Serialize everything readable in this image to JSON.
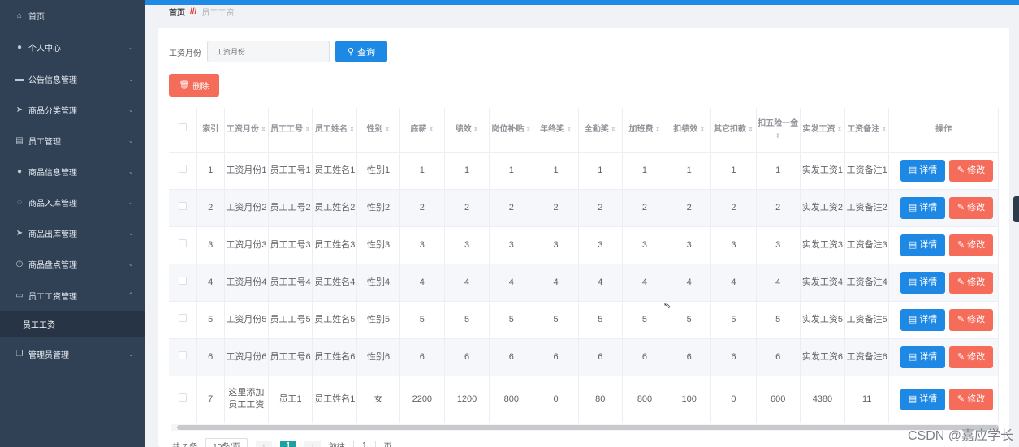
{
  "colors": {
    "primary": "#1e88e5",
    "danger": "#f56c5b",
    "sidebar_bg": "#304156"
  },
  "sidebar": {
    "items": [
      {
        "icon": "home-icon",
        "glyph": "⌂",
        "label": "首页",
        "chevron": false
      },
      {
        "icon": "user-icon",
        "glyph": "●",
        "label": "个人中心",
        "chevron": true
      },
      {
        "icon": "notice-icon",
        "glyph": "▬",
        "label": "公告信息管理",
        "chevron": true
      },
      {
        "icon": "send-icon",
        "glyph": "➤",
        "label": "商品分类管理",
        "chevron": true
      },
      {
        "icon": "staff-icon",
        "glyph": "▤",
        "label": "员工管理",
        "chevron": true
      },
      {
        "icon": "goods-icon",
        "glyph": "●",
        "label": "商品信息管理",
        "chevron": true
      },
      {
        "icon": "inbound-icon",
        "glyph": "◌",
        "label": "商品入库管理",
        "chevron": true
      },
      {
        "icon": "outbound-icon",
        "glyph": "➤",
        "label": "商品出库管理",
        "chevron": true
      },
      {
        "icon": "clock-icon",
        "glyph": "◷",
        "label": "商品盘点管理",
        "chevron": true
      },
      {
        "icon": "salary-icon",
        "glyph": "▭",
        "label": "员工工资管理",
        "chevron": true
      },
      {
        "icon": "copy-icon",
        "glyph": "❐",
        "label": "管理员管理",
        "chevron": true
      }
    ],
    "submenu_label": "员工工资"
  },
  "breadcrumb": {
    "home": "首页",
    "separator": "///",
    "current": "员工工资"
  },
  "search": {
    "label": "工资月份",
    "placeholder": "工资月份",
    "query_label": "查询"
  },
  "delete_label": "删除",
  "table": {
    "headers": [
      "",
      "索引",
      "工资月份",
      "员工工号",
      "员工姓名",
      "性别",
      "底薪",
      "绩效",
      "岗位补贴",
      "年终奖",
      "全勤奖",
      "加班费",
      "扣绩效",
      "其它扣款",
      "扣五险一金",
      "实发工资",
      "工资备注",
      "操作"
    ],
    "detail_label": "详情",
    "edit_label": "修改",
    "rows": [
      [
        "1",
        "工资月份1",
        "员工工号1",
        "员工姓名1",
        "性别1",
        "1",
        "1",
        "1",
        "1",
        "1",
        "1",
        "1",
        "1",
        "1",
        "实发工资1",
        "工资备注1"
      ],
      [
        "2",
        "工资月份2",
        "员工工号2",
        "员工姓名2",
        "性别2",
        "2",
        "2",
        "2",
        "2",
        "2",
        "2",
        "2",
        "2",
        "2",
        "实发工资2",
        "工资备注2"
      ],
      [
        "3",
        "工资月份3",
        "员工工号3",
        "员工姓名3",
        "性别3",
        "3",
        "3",
        "3",
        "3",
        "3",
        "3",
        "3",
        "3",
        "3",
        "实发工资3",
        "工资备注3"
      ],
      [
        "4",
        "工资月份4",
        "员工工号4",
        "员工姓名4",
        "性别4",
        "4",
        "4",
        "4",
        "4",
        "4",
        "4",
        "4",
        "4",
        "4",
        "实发工资4",
        "工资备注4"
      ],
      [
        "5",
        "工资月份5",
        "员工工号5",
        "员工姓名5",
        "性别5",
        "5",
        "5",
        "5",
        "5",
        "5",
        "5",
        "5",
        "5",
        "5",
        "实发工资5",
        "工资备注5"
      ],
      [
        "6",
        "工资月份6",
        "员工工号6",
        "员工姓名6",
        "性别6",
        "6",
        "6",
        "6",
        "6",
        "6",
        "6",
        "6",
        "6",
        "6",
        "实发工资6",
        "工资备注6"
      ],
      [
        "7",
        "这里添加员工工资",
        "员工1",
        "员工姓名1",
        "女",
        "2200",
        "1200",
        "800",
        "0",
        "80",
        "800",
        "100",
        "0",
        "600",
        "4380",
        "11"
      ]
    ]
  },
  "pagination": {
    "total": "共 7 条",
    "page_size": "10条/页",
    "prev": "‹",
    "current_page": "1",
    "next": "›",
    "goto_prefix": "前往",
    "goto_value": "1",
    "goto_suffix": "页"
  },
  "watermark": "CSDN @嘉应学长"
}
